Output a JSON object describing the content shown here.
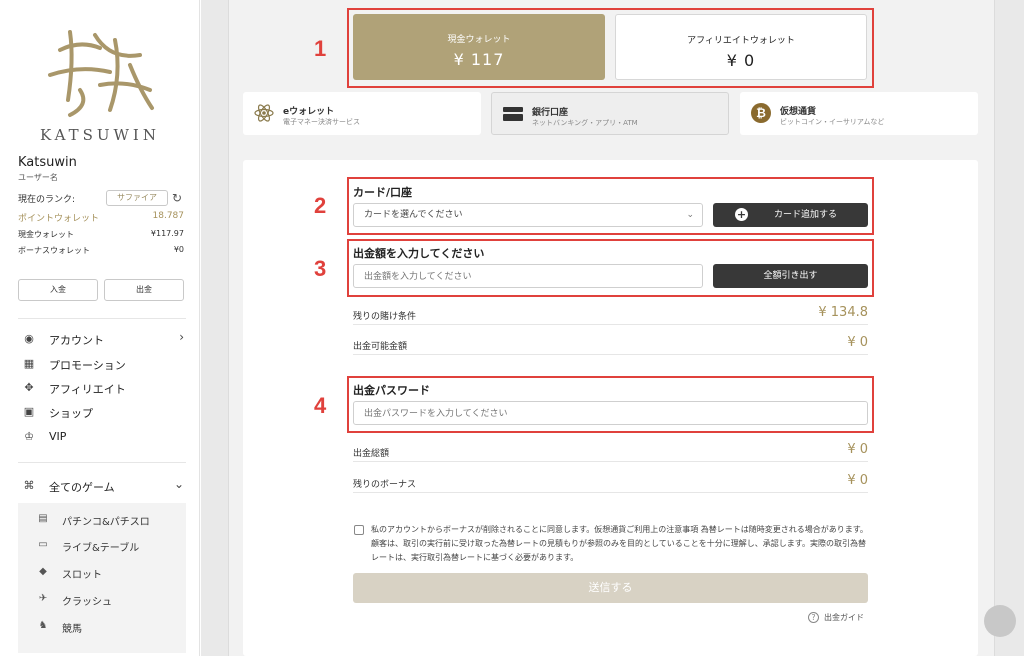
{
  "sidebar": {
    "logo_text": "KATSUWIN",
    "username": "Katsuwin",
    "username_caption": "ユーザー名",
    "rank_label": "現在のランク:",
    "rank_value": "サファイア",
    "point_wallet_label": "ポイントウォレット",
    "point_wallet_value": "18.787",
    "cash_wallet_label": "現金ウォレット",
    "cash_wallet_value": "¥117.97",
    "bonus_wallet_label": "ボーナスウォレット",
    "bonus_wallet_value": "¥0",
    "deposit_label": "入金",
    "withdraw_label": "出金",
    "nav": [
      {
        "label": "アカウント",
        "icon": "user-circle-icon"
      },
      {
        "label": "プロモーション",
        "icon": "calendar-icon"
      },
      {
        "label": "アフィリエイト",
        "icon": "handshake-icon"
      },
      {
        "label": "ショップ",
        "icon": "shop-icon"
      },
      {
        "label": "VIP",
        "icon": "crown-icon"
      }
    ],
    "all_games_label": "全てのゲーム",
    "games": [
      {
        "label": "パチンコ&パチスロ",
        "icon": "pachinko-icon"
      },
      {
        "label": "ライブ&テーブル",
        "icon": "live-table-icon"
      },
      {
        "label": "スロット",
        "icon": "slot-icon"
      },
      {
        "label": "クラッシュ",
        "icon": "crash-icon"
      },
      {
        "label": "競馬",
        "icon": "horse-icon"
      }
    ]
  },
  "wallets": {
    "cash_title": "現金ウォレット",
    "cash_value": "¥ 117",
    "affiliate_title": "アフィリエイトウォレット",
    "affiliate_value": "¥ 0"
  },
  "methods": [
    {
      "title": "eウォレット",
      "subtitle": "電子マネー決済サービス",
      "icon": "atom-icon"
    },
    {
      "title": "銀行口座",
      "subtitle": "ネットバンキング・アプリ・ATM",
      "icon": "bank-icon"
    },
    {
      "title": "仮想通貨",
      "subtitle": "ビットコイン・イーサリアムなど",
      "icon": "bitcoin-icon"
    }
  ],
  "steps": [
    "1",
    "2",
    "3",
    "4"
  ],
  "form": {
    "card_title": "カード/口座",
    "card_select": "カードを選んでください",
    "add_card_label": "カード追加する",
    "amount_title": "出金額を入力してください",
    "amount_placeholder": "出金額を入力してください",
    "withdraw_all_label": "全額引き出す",
    "remaining_wager_label": "残りの賭け条件",
    "remaining_wager_value": "¥ 134.8",
    "withdrawable_label": "出金可能金額",
    "withdrawable_value": "¥ 0",
    "password_title": "出金パスワード",
    "password_placeholder": "出金パスワードを入力してください",
    "total_label": "出金総額",
    "total_value": "¥ 0",
    "remaining_bonus_label": "残りのボーナス",
    "remaining_bonus_value": "¥ 0",
    "agree_text": "私のアカウントからボーナスが削除されることに同意します。仮想通貨ご利用上の注意事項 為替レートは随時変更される場合があります。顧客は、取引の実行前に受け取った為替レートの見積もりが参照のみを目的としていることを十分に理解し、承認します。実際の取引為替レートは、実行取引為替レートに基づく必要があります。",
    "submit_label": "送信する",
    "guide_label": "出金ガイド"
  },
  "colors": {
    "gold": "#b0a278",
    "accent_red": "#e0413c",
    "dark_button": "#383838"
  }
}
